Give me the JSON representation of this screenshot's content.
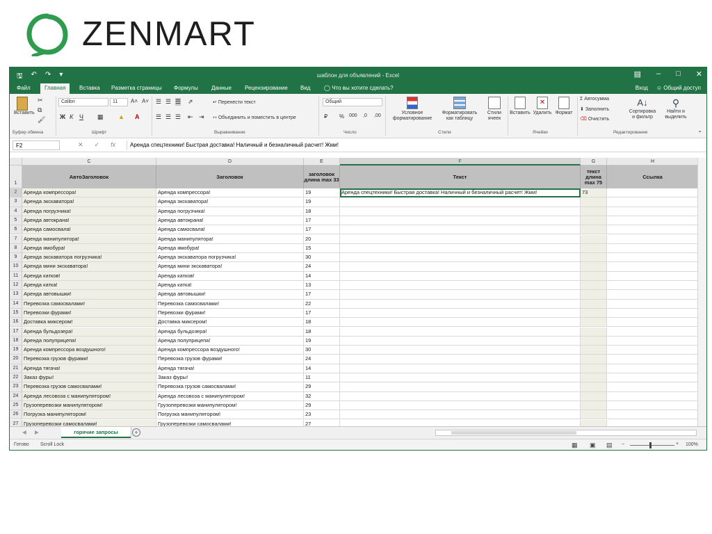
{
  "logo": {
    "text": "ZENMART",
    "color": "#2e9b4f"
  },
  "titlebar": {
    "title": "шаблон для объявлений - Excel",
    "qat_icons": [
      "save-icon",
      "undo-icon",
      "redo-icon",
      "customize-icon"
    ]
  },
  "tabs": [
    "Файл",
    "Главная",
    "Вставка",
    "Разметка страницы",
    "Формулы",
    "Данные",
    "Рецензирование",
    "Вид"
  ],
  "tell_me": "Что вы хотите сделать?",
  "account": {
    "signin": "Вход",
    "share": "Общий доступ"
  },
  "ribbon": {
    "paste": "Вставить",
    "clipboard": "Буфер обмена",
    "font_name": "Calibri",
    "font_size": "11",
    "font_group": "Шрифт",
    "wrap": "Перенести текст",
    "merge": "Объединить и поместить в центре",
    "alignment_group": "Выравнивание",
    "number_format": "Общий",
    "number_group": "Число",
    "cond_format": [
      "Условное",
      "форматирование"
    ],
    "format_table": [
      "Форматировать",
      "как таблицу"
    ],
    "cell_styles": [
      "Стили",
      "ячеек"
    ],
    "styles_group": "Стили",
    "insert": "Вставить",
    "delete": "Удалить",
    "format": "Формат",
    "cells_group": "Ячейки",
    "autosum": "Автосумма",
    "fill": "Заполнить",
    "clear": "Очистить",
    "sort": [
      "Сортировка",
      "и фильтр"
    ],
    "find": [
      "Найти и",
      "выделить"
    ],
    "editing_group": "Редактирование"
  },
  "formula_bar": {
    "name_box": "F2",
    "fx": "fx",
    "content": "Аренда спецтехники! Быстрая доставка! Наличный и безналичный расчет! Жми!"
  },
  "columns": [
    "C",
    "D",
    "E",
    "F",
    "G",
    "H"
  ],
  "headers": {
    "C": "АвтоЗаголовок",
    "D": "Заголовок",
    "E": "заголовок длина max 33",
    "F": "Текст",
    "G": "текст длина max 75",
    "H": "Ссылка"
  },
  "rows": [
    {
      "n": "2",
      "c": "Аренда компрессора!",
      "d": "Аренда компрессора!",
      "e": "19",
      "f": "Аренда спецтехники! Быстрая доставка! Наличный и безналичный расчет! Жми!",
      "g": "73"
    },
    {
      "n": "3",
      "c": "Аренда экскаватора!",
      "d": "Аренда экскаватора!",
      "e": "19",
      "f": "",
      "g": ""
    },
    {
      "n": "4",
      "c": "Аренда погрузчика!",
      "d": "Аренда погрузчика!",
      "e": "18",
      "f": "",
      "g": ""
    },
    {
      "n": "5",
      "c": "Аренда автокрана!",
      "d": "Аренда автокрана!",
      "e": "17",
      "f": "",
      "g": ""
    },
    {
      "n": "6",
      "c": "Аренда самосвала!",
      "d": "Аренда самосвала!",
      "e": "17",
      "f": "",
      "g": ""
    },
    {
      "n": "7",
      "c": "Аренда манипулятора!",
      "d": "Аренда манипулятора!",
      "e": "20",
      "f": "",
      "g": ""
    },
    {
      "n": "8",
      "c": "Аренда ямобура!",
      "d": "Аренда ямобура!",
      "e": "15",
      "f": "",
      "g": ""
    },
    {
      "n": "9",
      "c": "Аренда экскаватора погрузчика!",
      "d": "Аренда экскаватора погрузчика!",
      "e": "30",
      "f": "",
      "g": ""
    },
    {
      "n": "10",
      "c": "Аренда мини экскаватора!",
      "d": "Аренда мини экскаватора!",
      "e": "24",
      "f": "",
      "g": ""
    },
    {
      "n": "11",
      "c": "Аренда катков!",
      "d": "Аренда катков!",
      "e": "14",
      "f": "",
      "g": ""
    },
    {
      "n": "12",
      "c": "Аренда катка!",
      "d": "Аренда катка!",
      "e": "13",
      "f": "",
      "g": ""
    },
    {
      "n": "13",
      "c": "Аренда автовышки!",
      "d": "Аренда автовышки!",
      "e": "17",
      "f": "",
      "g": ""
    },
    {
      "n": "14",
      "c": "Перевозка самосвалами!",
      "d": "Перевозка самосвалами!",
      "e": "22",
      "f": "",
      "g": ""
    },
    {
      "n": "15",
      "c": "Перевозки фурами!",
      "d": "Перевозки фурами!",
      "e": "17",
      "f": "",
      "g": ""
    },
    {
      "n": "16",
      "c": "Доставка миксером!",
      "d": "Доставка миксером!",
      "e": "18",
      "f": "",
      "g": ""
    },
    {
      "n": "17",
      "c": "Аренда бульдозера!",
      "d": "Аренда бульдозера!",
      "e": "18",
      "f": "",
      "g": ""
    },
    {
      "n": "18",
      "c": "Аренда полуприцепа!",
      "d": "Аренда полуприцепа!",
      "e": "19",
      "f": "",
      "g": ""
    },
    {
      "n": "19",
      "c": "Аренда компрессора воздушного!",
      "d": "Аренда компрессора воздушного!",
      "e": "30",
      "f": "",
      "g": ""
    },
    {
      "n": "20",
      "c": "Перевозка грузов фурами!",
      "d": "Перевозка грузов фурами!",
      "e": "24",
      "f": "",
      "g": ""
    },
    {
      "n": "21",
      "c": "Аренда тягача!",
      "d": "Аренда тягача!",
      "e": "14",
      "f": "",
      "g": ""
    },
    {
      "n": "22",
      "c": "Заказ фуры!",
      "d": "Заказ фуры!",
      "e": "11",
      "f": "",
      "g": ""
    },
    {
      "n": "23",
      "c": "Перевозка грузов самосвалами!",
      "d": "Перевозка грузов самосвалами!",
      "e": "29",
      "f": "",
      "g": ""
    },
    {
      "n": "24",
      "c": "Аренда лесовоза с манипулятором!",
      "d": "Аренда лесовоза с манипулятором!",
      "e": "32",
      "f": "",
      "g": ""
    },
    {
      "n": "25",
      "c": "Грузоперевозки манипулятором!",
      "d": "Грузоперевозки манипулятором!",
      "e": "29",
      "f": "",
      "g": ""
    },
    {
      "n": "26",
      "c": "Погрузка манипулятором!",
      "d": "Погрузка манипулятором!",
      "e": "23",
      "f": "",
      "g": ""
    },
    {
      "n": "27",
      "c": "Грузоперевозки самосвалами!",
      "d": "Грузоперевозки самосвалами!",
      "e": "27",
      "f": "",
      "g": ""
    }
  ],
  "header_row_num": "1",
  "sheet_tab": "горячие запросы",
  "status": {
    "ready": "Готово",
    "scroll_lock": "Scroll Lock",
    "zoom": "100%"
  },
  "colors": {
    "excel_green": "#217346",
    "header_gray": "#c0c0c0",
    "tint": "#efefe6"
  }
}
